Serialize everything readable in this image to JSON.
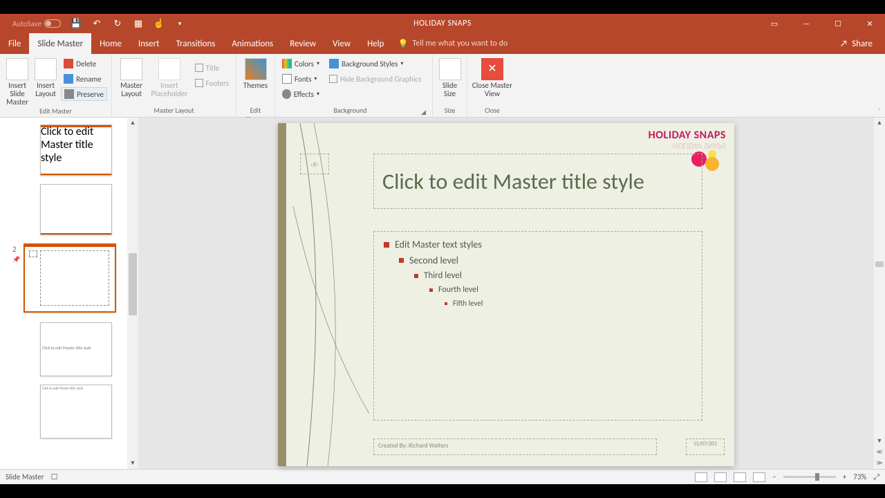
{
  "titlebar": {
    "autosave": "AutoSave",
    "title": "HOLIDAY SNAPS"
  },
  "tabs": {
    "file": "File",
    "slidemaster": "Slide Master",
    "home": "Home",
    "insert": "Insert",
    "transitions": "Transitions",
    "animations": "Animations",
    "review": "Review",
    "view": "View",
    "help": "Help",
    "tellme": "Tell me what you want to do",
    "share": "Share"
  },
  "ribbon": {
    "insert_slide_master": "Insert Slide Master",
    "insert_layout": "Insert Layout",
    "delete": "Delete",
    "rename": "Rename",
    "preserve": "Preserve",
    "edit_master_group": "Edit Master",
    "master_layout": "Master Layout",
    "insert_placeholder": "Insert Placeholder",
    "title_chk": "Title",
    "footers_chk": "Footers",
    "master_layout_group": "Master Layout",
    "themes": "Themes",
    "edit_theme_group": "Edit Theme",
    "colors": "Colors",
    "fonts": "Fonts",
    "effects": "Effects",
    "background_styles": "Background Styles",
    "hide_bg": "Hide Background Graphics",
    "background_group": "Background",
    "slide_size": "Slide Size",
    "size_group": "Size",
    "close_master": "Close Master View",
    "close_group": "Close"
  },
  "thumbs": {
    "selected_index": "2"
  },
  "slide": {
    "logo": "HOLIDAY SNAPS",
    "num_placeholder": "‹#›",
    "title_placeholder": "Click to edit Master title style",
    "body": {
      "lvl1": "Edit Master text styles",
      "lvl2": "Second level",
      "lvl3": "Third level",
      "lvl4": "Fourth level",
      "lvl5": "Fifth level"
    },
    "footer": "Created By: Richard Walters",
    "date": "15/07/201"
  },
  "status": {
    "mode": "Slide Master",
    "zoom": "73%"
  }
}
